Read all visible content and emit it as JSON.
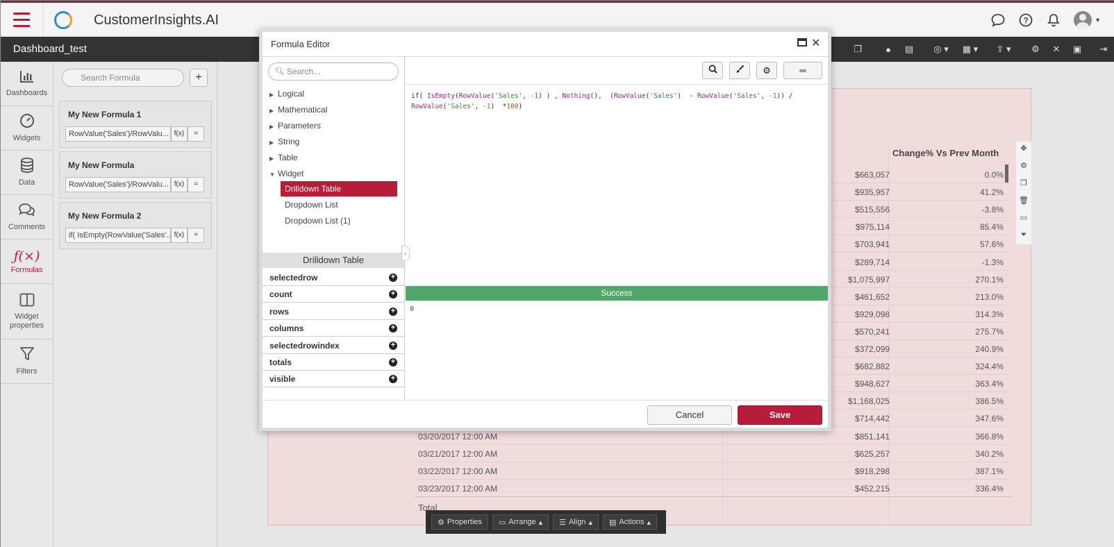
{
  "app": {
    "title": "CustomerInsights.AI",
    "dashboard_title": "Dashboard_test"
  },
  "rail": [
    {
      "label": "Dashboards",
      "icon": "bar-chart-icon"
    },
    {
      "label": "Widgets",
      "icon": "gauge-icon"
    },
    {
      "label": "Data",
      "icon": "database-icon"
    },
    {
      "label": "Comments",
      "icon": "comments-icon"
    },
    {
      "label": "Formulas",
      "icon": "function-icon"
    },
    {
      "label": "Widget properties",
      "icon": "columns-icon"
    },
    {
      "label": "Filters",
      "icon": "filter-icon"
    }
  ],
  "formulas_panel": {
    "search_placeholder": "Search Formula",
    "add_label": "+",
    "fx_label": "f(x)",
    "eq_label": "=",
    "cards": [
      {
        "title": "My New Formula 1",
        "value": "RowValue('Sales')/RowValu..."
      },
      {
        "title": "My New Formula",
        "value": "RowValue('Sales')/RowValu..."
      },
      {
        "title": "My New Formula 2",
        "value": "if( IsEmpty(RowValue('Sales'..."
      }
    ]
  },
  "table": {
    "header_change": "Change% Vs Prev Month",
    "rows": [
      {
        "date": "",
        "sales": "$663,057",
        "change": "0.0%"
      },
      {
        "date": "",
        "sales": "$935,957",
        "change": "41.2%"
      },
      {
        "date": "",
        "sales": "$515,556",
        "change": "-3.8%"
      },
      {
        "date": "",
        "sales": "$975,114",
        "change": "85.4%"
      },
      {
        "date": "",
        "sales": "$703,941",
        "change": "57.6%"
      },
      {
        "date": "",
        "sales": "$289,714",
        "change": "-1.3%"
      },
      {
        "date": "",
        "sales": "$1,075,997",
        "change": "270.1%"
      },
      {
        "date": "",
        "sales": "$461,652",
        "change": "213.0%"
      },
      {
        "date": "",
        "sales": "$929,098",
        "change": "314.3%"
      },
      {
        "date": "",
        "sales": "$570,241",
        "change": "275.7%"
      },
      {
        "date": "",
        "sales": "$372,099",
        "change": "240.9%"
      },
      {
        "date": "",
        "sales": "$682,882",
        "change": "324.4%"
      },
      {
        "date": "",
        "sales": "$948,627",
        "change": "363.4%"
      },
      {
        "date": "",
        "sales": "$1,168,025",
        "change": "386.5%"
      },
      {
        "date": "",
        "sales": "$714,442",
        "change": "347.6%"
      },
      {
        "date": "03/20/2017 12:00 AM",
        "sales": "$851,141",
        "change": "366.8%"
      },
      {
        "date": "03/21/2017 12:00 AM",
        "sales": "$625,257",
        "change": "340.2%"
      },
      {
        "date": "03/22/2017 12:00 AM",
        "sales": "$918,298",
        "change": "387.1%"
      },
      {
        "date": "03/23/2017 12:00 AM",
        "sales": "$452,215",
        "change": "336.4%"
      }
    ],
    "total_label": "Total"
  },
  "bottom_bar": {
    "properties": "Properties",
    "arrange": "Arrange",
    "align": "Align",
    "actions": "Actions"
  },
  "modal": {
    "title": "Formula Editor",
    "search_placeholder": "Search...",
    "tree": [
      {
        "label": "Logical",
        "expanded": false
      },
      {
        "label": "Mathematical",
        "expanded": false
      },
      {
        "label": "Parameters",
        "expanded": false
      },
      {
        "label": "String",
        "expanded": false
      },
      {
        "label": "Table",
        "expanded": false
      },
      {
        "label": "Widget",
        "expanded": true
      }
    ],
    "widget_children": [
      "Drilldown Table",
      "Dropdown List",
      "Dropdown List (1)"
    ],
    "selected_child": "Drilldown Table",
    "section_title": "Drilldown Table",
    "properties": [
      "selectedrow",
      "count",
      "rows",
      "columns",
      "selectedrowindex",
      "totals",
      "visible"
    ],
    "code_line1_parts": [
      "if( ",
      "IsEmpty",
      "(",
      "RowValue",
      "(",
      "'Sales'",
      ", ",
      "-1",
      ") ) , ",
      "Nothing",
      "(),  (",
      "RowValue",
      "(",
      "'Sales'",
      ")  - ",
      "RowValue",
      "(",
      "'Sales'",
      ", ",
      "-1",
      ")) /"
    ],
    "code_line2_parts": [
      "RowValue",
      "(",
      "'Sales'",
      ", ",
      "-1",
      ")  *",
      "100",
      ")"
    ],
    "status": "Success",
    "result": "0",
    "cancel_label": "Cancel",
    "save_label": "Save"
  }
}
